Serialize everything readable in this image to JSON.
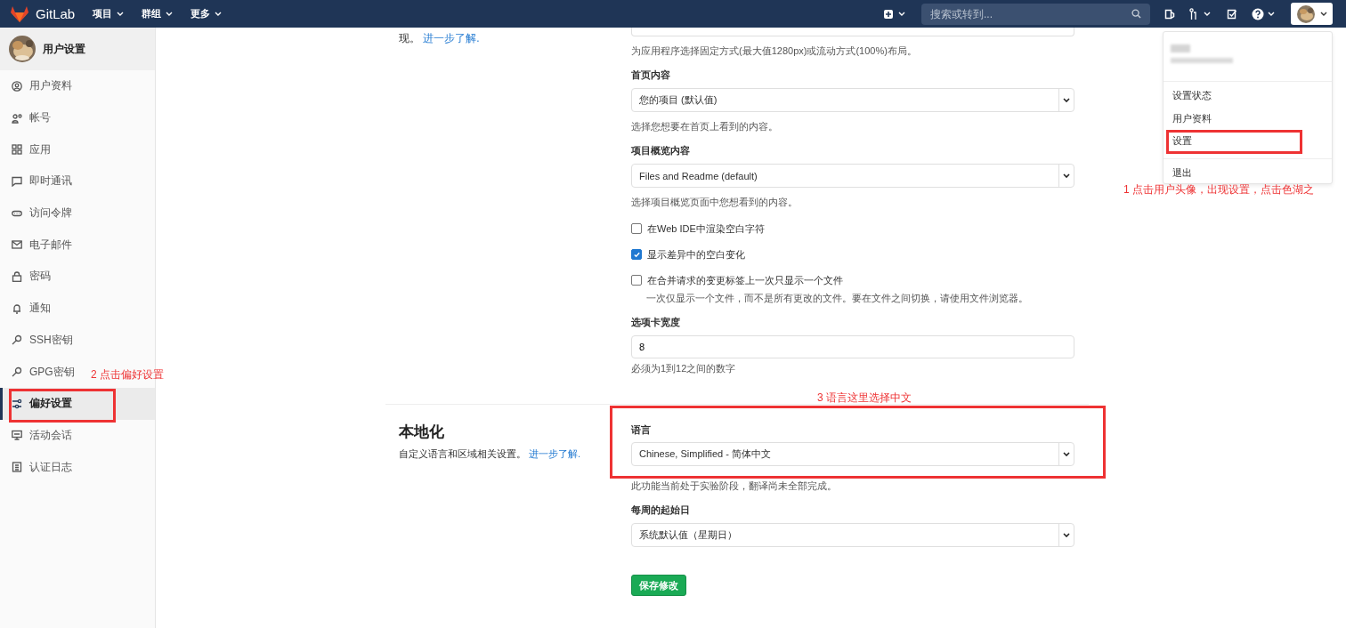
{
  "topbar": {
    "brand": "GitLab",
    "menus": [
      {
        "label": "项目"
      },
      {
        "label": "群组"
      },
      {
        "label": "更多"
      }
    ],
    "search": {
      "placeholder": "搜索或转到..."
    }
  },
  "user_menu": {
    "items": [
      {
        "label": "设置状态",
        "annotated": false
      },
      {
        "label": "用户资料",
        "annotated": false
      },
      {
        "label": "设置",
        "annotated": true
      },
      {
        "label": "退出",
        "annotated": false
      }
    ]
  },
  "sidebar": {
    "title": "用户设置",
    "items": [
      {
        "label": "用户资料",
        "selected": false,
        "annotated": false
      },
      {
        "label": "帐号",
        "selected": false,
        "annotated": false
      },
      {
        "label": "应用",
        "selected": false,
        "annotated": false
      },
      {
        "label": "即时通讯",
        "selected": false,
        "annotated": false
      },
      {
        "label": "访问令牌",
        "selected": false,
        "annotated": false
      },
      {
        "label": "电子邮件",
        "selected": false,
        "annotated": false
      },
      {
        "label": "密码",
        "selected": false,
        "annotated": false
      },
      {
        "label": "通知",
        "selected": false,
        "annotated": false
      },
      {
        "label": "SSH密钥",
        "selected": false,
        "annotated": false
      },
      {
        "label": "GPG密钥",
        "selected": false,
        "annotated": false
      },
      {
        "label": "偏好设置",
        "selected": true,
        "annotated": true
      },
      {
        "label": "活动会话",
        "selected": false,
        "annotated": false
      },
      {
        "label": "认证日志",
        "selected": false,
        "annotated": false
      }
    ]
  },
  "preferences": {
    "intro": {
      "text": "现。",
      "link": "进一步了解."
    },
    "fields": [
      {
        "kind": "hint",
        "text": "为应用程序选择固定方式(最大值1280px)或流动方式(100%)布局。"
      },
      {
        "kind": "select",
        "label": "首页内容",
        "value": "您的项目 (默认值)",
        "hint": "选择您想要在首页上看到的内容。"
      },
      {
        "kind": "select",
        "label": "项目概览内容",
        "value": "Files and Readme (default)",
        "hint": "选择项目概览页面中您想看到的内容。"
      },
      {
        "kind": "checkbox",
        "label": "在Web IDE中渲染空白字符",
        "checked": false
      },
      {
        "kind": "checkbox",
        "label": "显示差异中的空白变化",
        "checked": true
      },
      {
        "kind": "checkbox",
        "label": "在合并请求的变更标签上一次只显示一个文件",
        "checked": false,
        "hint": "一次仅显示一个文件，而不是所有更改的文件。要在文件之间切换，请使用文件浏览器。"
      },
      {
        "kind": "input",
        "label": "选项卡宽度",
        "value": "8",
        "hint": "必须为1到12之间的数字"
      }
    ]
  },
  "localization": {
    "title": "本地化",
    "description": "自定义语言和区域相关设置。",
    "link": "进一步了解.",
    "annotated": true,
    "fields": [
      {
        "kind": "select",
        "label": "语言",
        "value": "Chinese, Simplified - 简体中文",
        "hint": "此功能当前处于实验阶段，翻译尚未全部完成。"
      },
      {
        "kind": "select",
        "label": "每周的起始日",
        "value": "系统默认值（星期日）"
      }
    ]
  },
  "save_button": "保存修改",
  "annotations": [
    {
      "text": "1 点击用户头像，出现设置，点击色湖之"
    },
    {
      "text": "2 点击偏好设置"
    },
    {
      "text": "3 语言这里选择中文"
    }
  ]
}
